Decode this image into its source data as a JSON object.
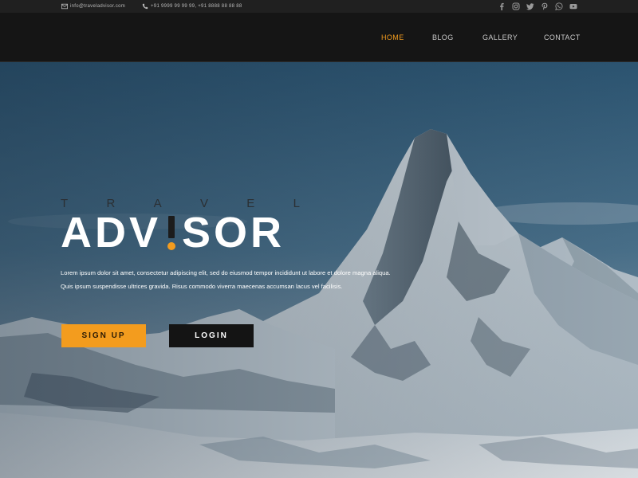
{
  "topbar": {
    "email": "info@traveladvisor.com",
    "phone": "+91 9999 99 99 99, +91 8888 88 88 88",
    "social": [
      "facebook-icon",
      "instagram-icon",
      "twitter-icon",
      "pinterest-icon",
      "whatsapp-icon",
      "youtube-icon"
    ]
  },
  "nav": {
    "items": [
      {
        "label": "HOME",
        "active": true
      },
      {
        "label": "BLOG",
        "active": false
      },
      {
        "label": "GALLERY",
        "active": false
      },
      {
        "label": "CONTACT",
        "active": false
      }
    ]
  },
  "hero": {
    "brand_small_letters": [
      "T",
      "R",
      "A",
      "V",
      "E",
      "L"
    ],
    "brand_big_left": "ADV",
    "brand_big_right": "SOR",
    "lead_line1": "Lorem ipsum dolor sit amet, consectetur adipiscing elit, sed do eiusmod tempor incididunt ut labore et dolore magna aliqua.",
    "lead_line2": "Quis ipsum suspendisse ultrices gravida. Risus commodo viverra maecenas accumsan lacus vel facilisis.",
    "signup_label": "SIGN UP",
    "login_label": "LOGIN"
  },
  "colors": {
    "accent": "#f39c1e",
    "nav_bg": "#151515",
    "topbar_bg": "#202020"
  }
}
